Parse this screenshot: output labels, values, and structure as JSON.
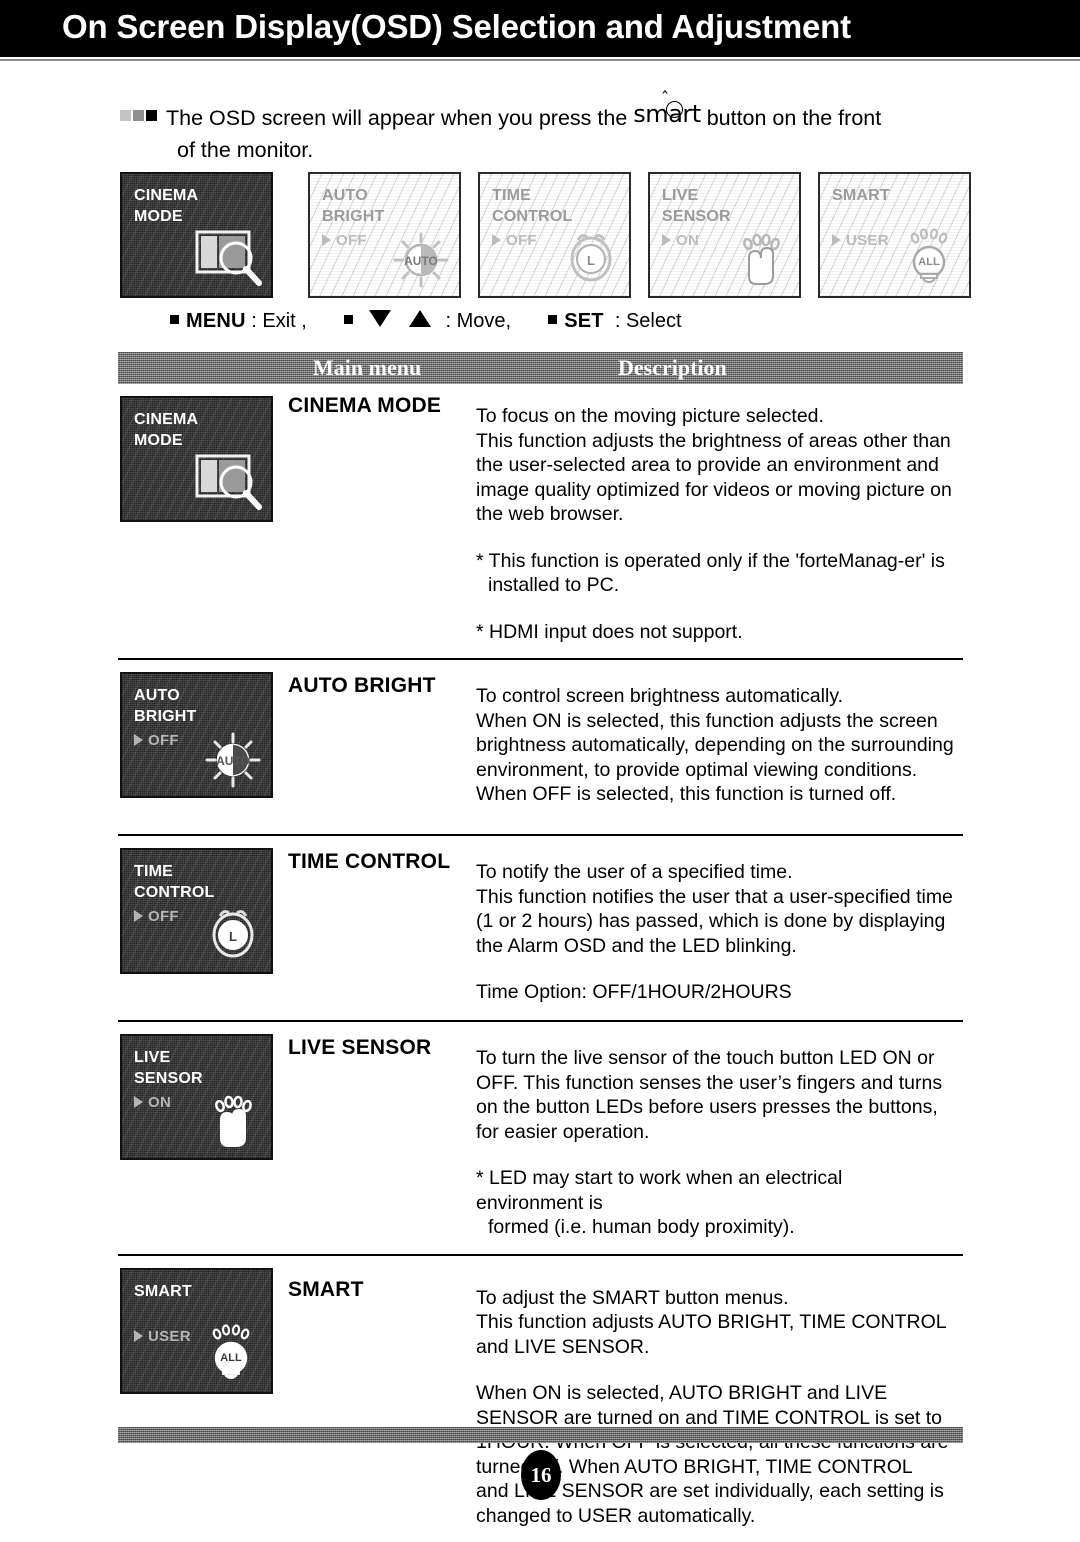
{
  "header": {
    "title": "On Screen Display(OSD) Selection and Adjustment"
  },
  "intro": {
    "bullet_icons": [
      "square-light-icon",
      "square-medium-icon",
      "square-dark-icon"
    ],
    "line1_before": "The OSD screen will appear when you press the",
    "logo": "smart",
    "line1_after": "button on the front",
    "line2": "of the monitor."
  },
  "osd_strip": [
    {
      "title": "CINEMA\nMODE",
      "value": "",
      "glyph": "magnifier-screen-icon",
      "style": "dark"
    },
    {
      "title": "AUTO\nBRIGHT",
      "value": "OFF",
      "glyph": "auto-sun-icon",
      "style": "faded"
    },
    {
      "title": "TIME\nCONTROL",
      "value": "OFF",
      "glyph": "alarm-clock-icon",
      "style": "faded"
    },
    {
      "title": "LIVE\nSENSOR",
      "value": "ON",
      "glyph": "hand-touch-icon",
      "style": "faded"
    },
    {
      "title": "SMART",
      "value": "USER",
      "glyph": "bulb-all-icon",
      "style": "faded"
    }
  ],
  "legend": {
    "menu_label": "MENU",
    "menu_action": ": Exit ,",
    "move_action": ": Move,",
    "set_label": "SET",
    "set_action": ": Select"
  },
  "table": {
    "head": {
      "main_menu": "Main menu",
      "description": "Description"
    },
    "rows": [
      {
        "thumb": {
          "title": "CINEMA\nMODE",
          "value": "",
          "glyph": "magnifier-screen-icon",
          "style": "dark"
        },
        "label": "CINEMA MODE",
        "paragraphs": [
          "To focus on the moving picture selected.\nThis function adjusts the brightness of areas other than the user-selected area to provide an environment and image quality optimized for videos or moving picture on the web browser.",
          "* This function is operated only if the 'forteManag-er' is",
          "installed to PC.",
          "* HDMI input does not support."
        ],
        "desc_lines": [
          "To focus on the moving picture selected.",
          "This function adjusts the brightness of areas other than",
          "the user-selected area to provide an environment and",
          "image quality optimized for videos or moving picture on",
          "the web browser."
        ],
        "note1_line1": "* This function is operated only if the 'forteManag-er' is",
        "note1_line2": "installed to PC.",
        "note2": "* HDMI input does not support."
      },
      {
        "thumb": {
          "title": "AUTO\nBRIGHT",
          "value": "OFF",
          "glyph": "auto-sun-icon",
          "style": "dark"
        },
        "label": "AUTO BRIGHT",
        "desc_lines": [
          "To control screen brightness automatically.",
          "When ON is selected, this function adjusts the screen",
          "brightness automatically, depending on the surrounding",
          "environment, to provide optimal viewing conditions.",
          "When OFF is selected, this function is turned off."
        ]
      },
      {
        "thumb": {
          "title": "TIME\nCONTROL",
          "value": "OFF",
          "glyph": "alarm-clock-icon",
          "style": "dark"
        },
        "label": "TIME CONTROL",
        "desc_lines": [
          "To notify the user of a specified time.",
          "This function notifies the user that a user-specified time",
          "(1 or 2 hours) has passed, which is done by displaying",
          "the Alarm OSD and the LED blinking."
        ],
        "extra": "Time Option: OFF/1HOUR/2HOURS"
      },
      {
        "thumb": {
          "title": "LIVE\nSENSOR",
          "value": "ON",
          "glyph": "hand-touch-icon",
          "style": "dark"
        },
        "label": "LIVE SENSOR",
        "desc_lines": [
          "To turn the live sensor of the touch button LED ON or",
          "OFF. This function senses the user’s fingers and turns",
          "on the button LEDs before users presses the buttons,",
          "for easier operation."
        ],
        "note1_line1": "* LED may start to work when an electrical environment is",
        "note1_line2": "formed (i.e. human body proximity)."
      },
      {
        "thumb": {
          "title": "SMART",
          "value": "USER",
          "glyph": "bulb-all-icon",
          "style": "dark"
        },
        "label": "SMART",
        "desc_lines": [
          "To adjust the SMART button menus.",
          "This function adjusts AUTO BRIGHT, TIME CONTROL",
          "and LIVE SENSOR."
        ],
        "desc_lines2": [
          "When ON is selected, AUTO BRIGHT and LIVE",
          "SENSOR are turned on and TIME CONTROL is set to",
          "1HOUR. When OFF is selected, all these functions are",
          "turned off. When AUTO BRIGHT, TIME CONTROL",
          "and LIVE SENSOR are set individually, each setting is",
          "changed to USER automatically."
        ]
      }
    ]
  },
  "footer": {
    "page_number": "16"
  }
}
